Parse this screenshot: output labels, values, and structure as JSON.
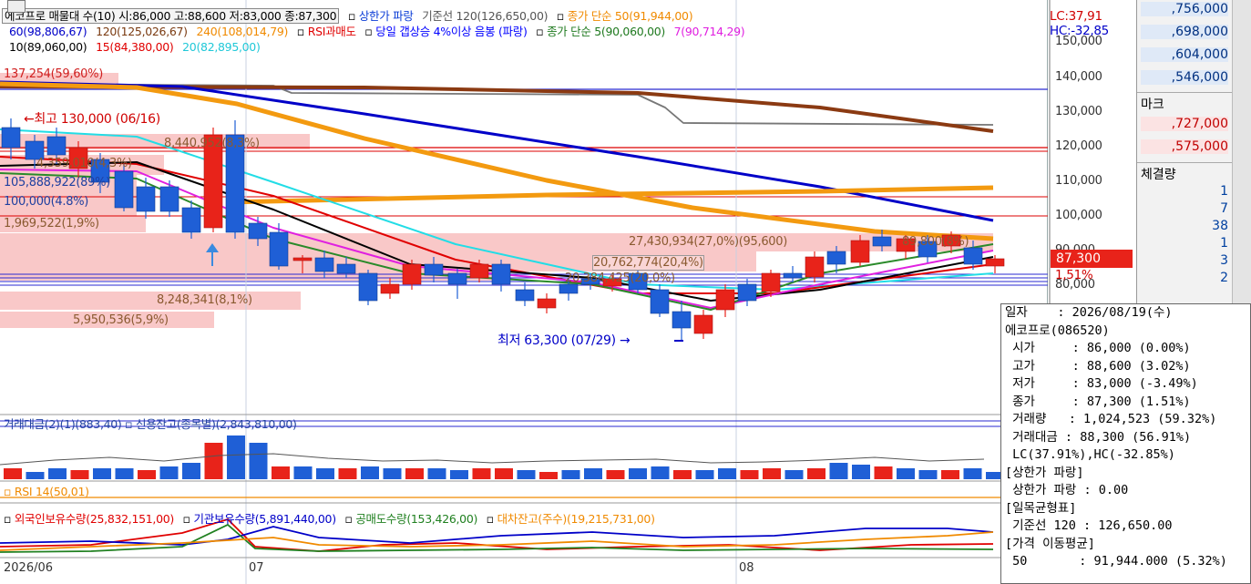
{
  "legend": {
    "line1": {
      "title": "에코프로 매물대 수(10) 시:86,000 고:88,600 저:83,000 종:87,300",
      "items": [
        {
          "label": "상한가 파랑",
          "color": "#0a3cd6"
        },
        {
          "label": "기준선 120(126,650,00)",
          "color": "#6b6b6b"
        },
        {
          "label": "종가 단순 50(91,944,00)",
          "color": "#f08a00"
        }
      ]
    },
    "line2": {
      "items": [
        {
          "label": "60(98,806,67)",
          "color": "#0000c8"
        },
        {
          "label": "120(125,026,67)",
          "color": "#7a3a10"
        },
        {
          "label": "240(108,014,79)",
          "color": "#f08a00"
        },
        {
          "label": "RSI과매도",
          "color": "#e00000"
        },
        {
          "label": "당일 갭상승 4%이상 음봉 (파랑)",
          "color": "#0000ff"
        },
        {
          "label": "종가 단순 5(90,060,00)",
          "color": "#207a20"
        },
        {
          "label": "7(90,714,29)",
          "color": "#e020e0"
        }
      ]
    },
    "line3": {
      "items": [
        {
          "label": "10(89,060,00)",
          "color": "#000000"
        },
        {
          "label": "15(84,380,00)",
          "color": "#e00000"
        },
        {
          "label": "20(82,895,00)",
          "color": "#20d8e0"
        }
      ]
    },
    "lc": "LC:37,91",
    "hc": "HC:-32,85"
  },
  "volume_profile_labels": [
    "137,254(59,60%)",
    "8,440,952(8,3%)",
    "4,359,010(4,3%)",
    "1,969,522(1,9%)",
    "27,430,934(27,0%)(95,600)",
    "89,800(8%)",
    "20,762,774(20,4%)",
    "8,248,341(8,1%)",
    "5,950,536(5,9%)",
    "20,384,425(20,0%)",
    "105,888,922(89%)",
    "100,000(4.8%)"
  ],
  "annotations": {
    "high": "←최고 130,000 (06/16)",
    "low": "최저 63,300 (07/29) →"
  },
  "y_axis": {
    "ticks": [
      "150,000",
      "140,000",
      "130,000",
      "120,000",
      "110,000",
      "100,000",
      "90,000",
      "80,000"
    ],
    "current_price": "87,300",
    "current_pct": "1,51%"
  },
  "sub_panels": {
    "volume_legend": "거래대금(2)(1)(883,40) ▫ 신용잔고(종목별)(2,843,810,00)",
    "rsi_legend": "RSI 14(50,01)",
    "holdings_legend": [
      {
        "label": "외국인보유수량(25,832,151,00)",
        "color": "#e00000"
      },
      {
        "label": "기관보유수량(5,891,440,00)",
        "color": "#0000c8"
      },
      {
        "label": "공매도수량(153,426,00)",
        "color": "#208020"
      },
      {
        "label": "대차잔고(주수)(19,215,731,00)",
        "color": "#f08a00"
      }
    ]
  },
  "x_axis": {
    "labels": [
      "2026/06",
      "07",
      "08"
    ]
  },
  "right_panel": {
    "prices_top": [
      ",756,000",
      ",698,000",
      ",604,000",
      ",546,000"
    ],
    "mark_label": "마크",
    "prices_mid": [
      ",727,000",
      ",575,000"
    ],
    "exec_label": "체결량",
    "exec_values": [
      "1",
      "7",
      "38",
      "1",
      "3",
      "2"
    ]
  },
  "info_box": {
    "date": "일자    : 2026/08/19(수)",
    "name": "에코프로(086520)",
    "open": " 시가     : 86,000 (0.00%)",
    "high": " 고가     : 88,600 (3.02%)",
    "low": " 저가     : 83,000 (-3.49%)",
    "close": " 종가     : 87,300 (1.51%)",
    "volume": " 거래량   : 1,024,523 (59.32%)",
    "amount": " 거래대금 : 88,300 (56.91%)",
    "lchc": " LC(37.91%),HC(-32.85%)",
    "sec1": "[상한가 파랑]",
    "sec1v": " 상한가 파랑 : 0.00",
    "sec2": "[일목균형표]",
    "sec2v": " 기준선 120 : 126,650.00",
    "sec3": "[가격 이동평균]",
    "sec3v": " 50       : 91,944.000 (5.32%)"
  },
  "colors": {
    "up": "#e8231a",
    "down": "#1f5fd6",
    "ma60": "#0000c8",
    "ma120": "#8b3a12",
    "ma240": "#f39a10",
    "ma5": "#2a8a2a",
    "ma7": "#e020e0",
    "ma10": "#000000",
    "ma15": "#e00000",
    "ma20": "#22dde6",
    "kijun": "#777777"
  }
}
